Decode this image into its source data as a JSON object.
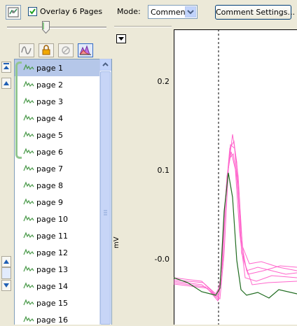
{
  "toolbar": {
    "overlay_label": "Overlay 6 Pages",
    "overlay_checked": true,
    "mode_label": "Mode:",
    "mode_value": "Comment",
    "comment_settings_label": "Comment Settings...",
    "slider_value_fraction": 0.38
  },
  "tools": [
    {
      "icon": "waveform-tool-icon",
      "active": false
    },
    {
      "icon": "lock-icon",
      "active": false
    },
    {
      "icon": "no-entry-icon",
      "active": false
    },
    {
      "icon": "chart-overlay-icon",
      "active": true
    }
  ],
  "pages": [
    {
      "label": "page 1",
      "selected": true
    },
    {
      "label": "page 2",
      "selected": false
    },
    {
      "label": "page 3",
      "selected": false
    },
    {
      "label": "page 4",
      "selected": false
    },
    {
      "label": "page 5",
      "selected": false
    },
    {
      "label": "page 6",
      "selected": false
    },
    {
      "label": "page 7",
      "selected": false
    },
    {
      "label": "page 8",
      "selected": false
    },
    {
      "label": "page 9",
      "selected": false
    },
    {
      "label": "page 10",
      "selected": false
    },
    {
      "label": "page 11",
      "selected": false
    },
    {
      "label": "page 12",
      "selected": false
    },
    {
      "label": "page 13",
      "selected": false
    },
    {
      "label": "page 14",
      "selected": false
    },
    {
      "label": "page 15",
      "selected": false
    },
    {
      "label": "page 16",
      "selected": false
    }
  ],
  "plot": {
    "ylabel": "mV",
    "yticks": [
      "0.2",
      "0.1",
      "-0.0"
    ],
    "colors": {
      "overlay": "#ff66cc",
      "current": "#1f6b1f",
      "marker": "#000000"
    }
  }
}
